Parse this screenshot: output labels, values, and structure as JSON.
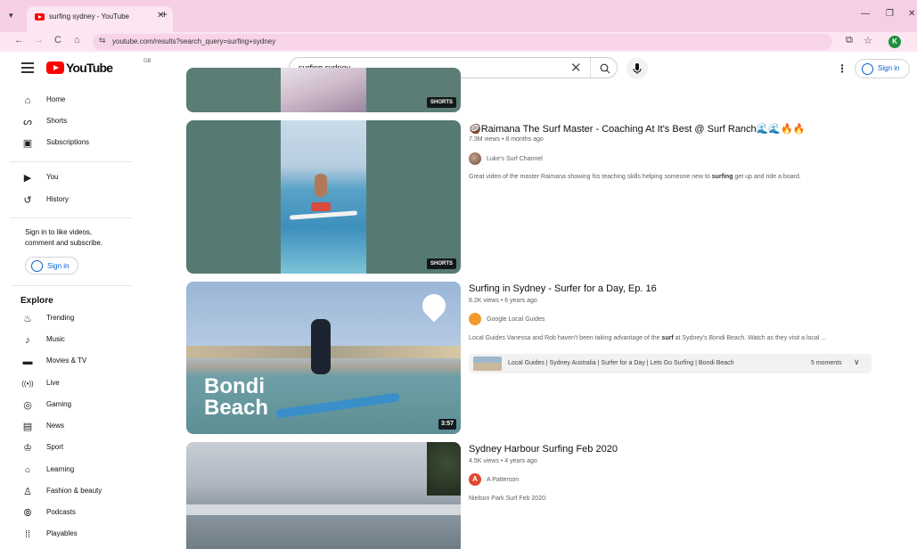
{
  "browser": {
    "tab_title": "surfing sydney - YouTube",
    "url": "youtube.com/results?search_query=surfing+sydney",
    "profile_initial": "K"
  },
  "masthead": {
    "logo_text": "YouTube",
    "country_code": "GB",
    "search_query": "surfing sydney",
    "signin_label": "Sign in"
  },
  "sidebar": {
    "main": [
      {
        "label": "Home",
        "icon": "home-icon"
      },
      {
        "label": "Shorts",
        "icon": "shorts-icon"
      },
      {
        "label": "Subscriptions",
        "icon": "subscriptions-icon"
      }
    ],
    "you": [
      {
        "label": "You",
        "icon": "you-icon"
      },
      {
        "label": "History",
        "icon": "history-icon"
      }
    ],
    "signin_prompt_line1": "Sign in to like videos,",
    "signin_prompt_line2": "comment and subscribe.",
    "signin_label": "Sign in",
    "explore_heading": "Explore",
    "explore": [
      {
        "label": "Trending",
        "icon": "trending-icon"
      },
      {
        "label": "Music",
        "icon": "music-icon"
      },
      {
        "label": "Movies & TV",
        "icon": "movies-icon"
      },
      {
        "label": "Live",
        "icon": "live-icon"
      },
      {
        "label": "Gaming",
        "icon": "gaming-icon"
      },
      {
        "label": "News",
        "icon": "news-icon"
      },
      {
        "label": "Sport",
        "icon": "sport-icon"
      },
      {
        "label": "Learning",
        "icon": "learning-icon"
      },
      {
        "label": "Fashion & beauty",
        "icon": "fashion-icon"
      },
      {
        "label": "Podcasts",
        "icon": "podcasts-icon"
      },
      {
        "label": "Playables",
        "icon": "playables-icon"
      }
    ]
  },
  "results": [
    {
      "badge": "SHORTS"
    },
    {
      "title": "🥥Raimana The Surf Master - Coaching At It's Best @ Surf Ranch🌊🌊🔥🔥",
      "meta": "7.3M views • 8 months ago",
      "channel": "Luke's Surf Channel",
      "description_pre": "Great video of the master Raimana showing his teaching skills helping someone new to ",
      "description_bold": "surfing",
      "description_post": " get up and ride a board.",
      "badge": "SHORTS"
    },
    {
      "title": "Surfing in Sydney - Surfer for a Day, Ep. 16",
      "meta": "8.2K views • 6 years ago",
      "channel": "Google Local Guides",
      "description_pre": "Local Guides Vanessa and Rob haven't been taking advantage of the ",
      "description_bold": "surf",
      "description_post": " at Sydney's Bondi Beach. Watch as they visit a local ...",
      "thumb_text_1": "Bondi",
      "thumb_text_2": "Beach",
      "duration": "3:57",
      "moments_text": "Local Guides | Sydney Australia | Surfer for a Day | Lets Go Surfing | Bondi Beach",
      "moments_count": "5 moments"
    },
    {
      "title": "Sydney Harbour Surfing Feb 2020",
      "meta": "4.5K views • 4 years ago",
      "channel": "A Patterson",
      "channel_initial": "A",
      "description": "Nielson Park Surf Feb 2020."
    }
  ]
}
